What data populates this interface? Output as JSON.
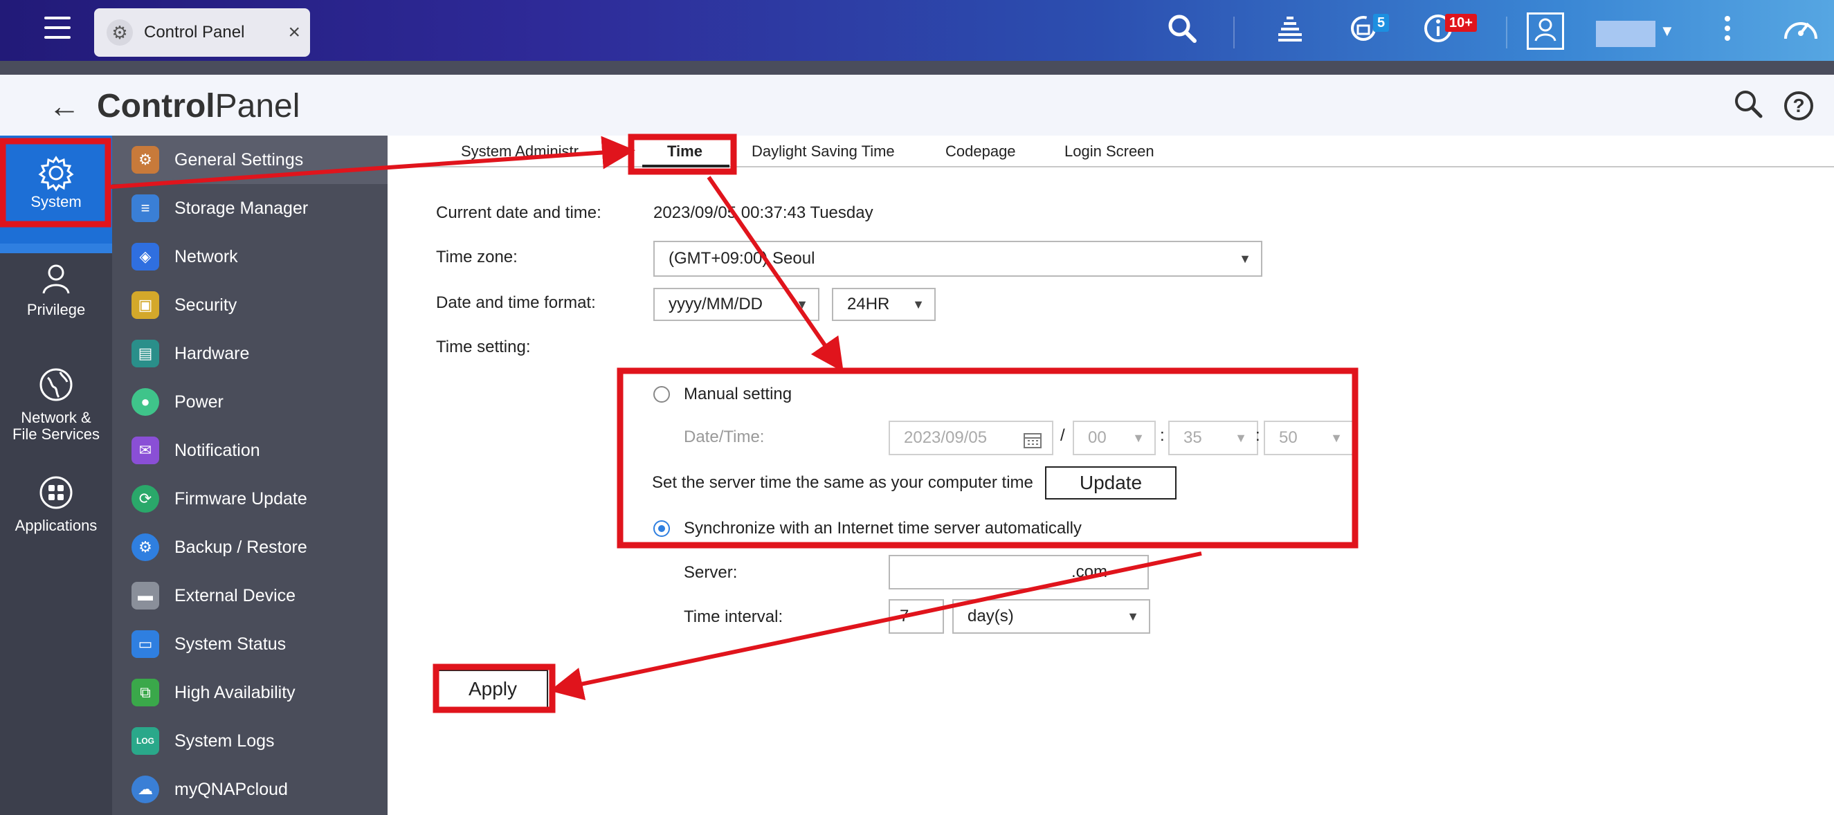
{
  "topbar": {
    "tab_label": "Control Panel",
    "close_glyph": "×",
    "notification_badge": "5",
    "info_badge": "10+",
    "icons": [
      "menu-icon",
      "gear-icon",
      "search-icon",
      "stack-icon",
      "refresh-icon",
      "info-icon",
      "user-icon",
      "more-icon",
      "dashboard-icon"
    ]
  },
  "header": {
    "title_bold": "Control",
    "title_rest": "Panel"
  },
  "rail": {
    "items": [
      {
        "label": "System",
        "icon": "gear-icon"
      },
      {
        "label": "Privilege",
        "icon": "user-icon"
      },
      {
        "label": "Network &\nFile Services",
        "line1": "Network &",
        "line2": "File Services",
        "icon": "globe-icon"
      },
      {
        "label": "Applications",
        "icon": "apps-icon"
      }
    ]
  },
  "submenu": {
    "items": [
      {
        "label": "General Settings",
        "icon": "settings-icon",
        "color": "#c87a3a"
      },
      {
        "label": "Storage Manager",
        "icon": "database-icon",
        "color": "#3a7fd6"
      },
      {
        "label": "Network",
        "icon": "network-icon",
        "color": "#2f6fe0"
      },
      {
        "label": "Security",
        "icon": "lock-icon",
        "color": "#d4a82a"
      },
      {
        "label": "Hardware",
        "icon": "hardware-icon",
        "color": "#2a8f8a"
      },
      {
        "label": "Power",
        "icon": "bulb-icon",
        "color": "#3fc48a"
      },
      {
        "label": "Notification",
        "icon": "notification-icon",
        "color": "#8a4fd6"
      },
      {
        "label": "Firmware Update",
        "icon": "firmware-icon",
        "color": "#2aa86a"
      },
      {
        "label": "Backup / Restore",
        "icon": "backup-icon",
        "color": "#2f7fe0"
      },
      {
        "label": "External Device",
        "icon": "drive-icon",
        "color": "#8a8f9a"
      },
      {
        "label": "System Status",
        "icon": "monitor-icon",
        "color": "#2f7fe0"
      },
      {
        "label": "High Availability",
        "icon": "availability-icon",
        "color": "#3aa84a"
      },
      {
        "label": "System Logs",
        "icon": "logs-icon",
        "color": "#2aa88a"
      },
      {
        "label": "myQNAPcloud",
        "icon": "cloud-icon",
        "color": "#3a7fd6"
      }
    ]
  },
  "tabs": [
    {
      "label": "System Administr"
    },
    {
      "label": "Time"
    },
    {
      "label": "Daylight Saving Time"
    },
    {
      "label": "Codepage"
    },
    {
      "label": "Login Screen"
    }
  ],
  "form": {
    "current_label": "Current date and time:",
    "current_value": "2023/09/05 00:37:43 Tuesday",
    "timezone_label": "Time zone:",
    "timezone_value": "(GMT+09:00) Seoul",
    "format_label": "Date and time format:",
    "date_format": "yyyy/MM/DD",
    "hour_format": "24HR",
    "time_setting_label": "Time setting:",
    "manual_label": "Manual setting",
    "datetime_label": "Date/Time:",
    "date_value": "2023/09/05",
    "slash": "/",
    "colon": ":",
    "hour": "00",
    "minute": "35",
    "second": "50",
    "sync_computer_label": "Set the server time the same as your computer time",
    "update_button": "Update",
    "sync_internet_label": "Synchronize with an Internet time server automatically",
    "server_label": "Server:",
    "server_value": ".com",
    "interval_label": "Time interval:",
    "interval_value": "7",
    "interval_unit": "day(s)",
    "apply_button": "Apply"
  },
  "colors": {
    "annotation_red": "#e0141c",
    "accent_blue": "#1d6fd6"
  }
}
